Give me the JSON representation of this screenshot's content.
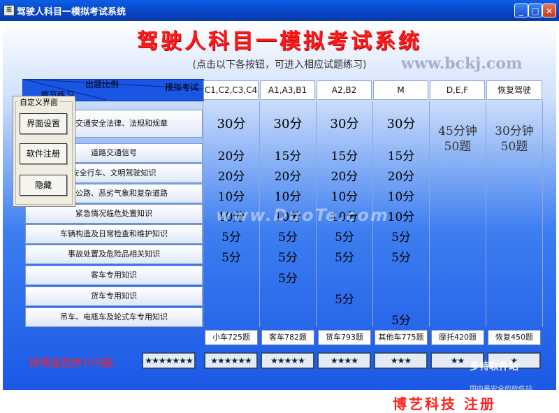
{
  "window": {
    "title": "驾驶人科目一模拟考试系统",
    "minimize": "_",
    "maximize": "□",
    "close": "✕"
  },
  "app": {
    "title": "驾驶人科目一模拟考试系统",
    "subtitle": "(点击以下各按钮，可进入相应试题练习)",
    "watermark_url": "www.bckj.com",
    "company": "博艺科技  注册"
  },
  "table": {
    "header_ratio": "出题比例",
    "header_mock": "模拟考试",
    "header_chapter": "章节练习",
    "columns": [
      "C1,C2,C3,C4",
      "A1,A3,B1",
      "A2,B2",
      "M",
      "D,E,F",
      "恢复驾驶"
    ],
    "rows": [
      {
        "label": "道路交通安全法律、法规和规章",
        "values": [
          "30分",
          "30分",
          "30分",
          "30分"
        ]
      },
      {
        "label": "道路交通信号",
        "values": [
          "20分",
          "15分",
          "15分",
          "15分"
        ]
      },
      {
        "label": "安全行车、文明驾驶知识",
        "values": [
          "20分",
          "20分",
          "20分",
          "20分"
        ]
      },
      {
        "label": "高速公路、恶劣气象和复杂道路",
        "values": [
          "10分",
          "10分",
          "10分",
          "10分"
        ]
      },
      {
        "label": "紧急情况临危处置知识",
        "values": [
          "10分",
          "10分",
          "10分",
          "10分"
        ]
      },
      {
        "label": "车辆构造及日常检查和维护知识",
        "values": [
          "5分",
          "5分",
          "5分",
          "5分"
        ]
      },
      {
        "label": "事故处置及危险品相关知识",
        "values": [
          "5分",
          "5分",
          "5分",
          "5分"
        ]
      },
      {
        "label": "客车专用知识",
        "values": [
          "",
          "5分",
          "",
          ""
        ]
      },
      {
        "label": "货车专用知识",
        "values": [
          "",
          "",
          "5分",
          ""
        ]
      },
      {
        "label": "吊车、电瓶车及轮式车专用知识",
        "values": [
          "",
          "",
          "",
          "5分"
        ]
      }
    ],
    "def_exam": "45分钟\n50题",
    "restore_exam": "30分钟\n50题"
  },
  "bank_buttons": [
    "小车725题",
    "客车782题",
    "货车793题",
    "其他车775题",
    "摩托420题",
    "恢复450题"
  ],
  "difficulty": {
    "label": "按难度选择100题:",
    "levels": [
      "★★★★★★★",
      "★★★★★★",
      "★★★★★",
      "★★★★",
      "★★★",
      "★★",
      "★"
    ]
  },
  "popup": {
    "title": "自定义界面",
    "buttons": [
      "界面设置",
      "软件注册",
      "隐藏"
    ]
  },
  "watermarks": {
    "mid": "www.DuoTe.com",
    "logo": "多特软件站",
    "logo_sub": "国内最安全的软件站"
  }
}
